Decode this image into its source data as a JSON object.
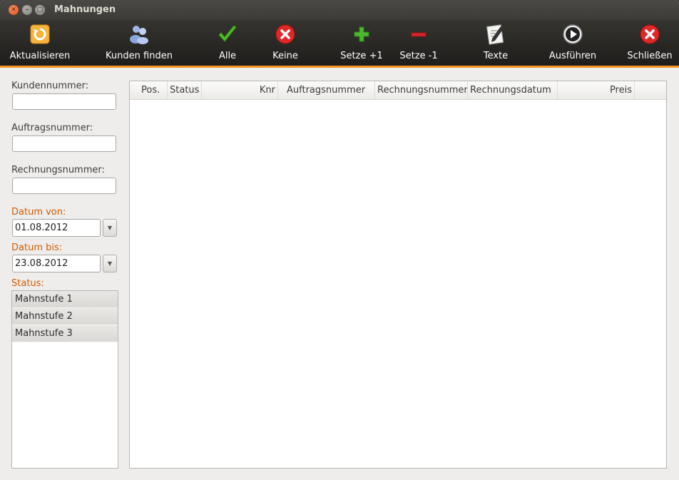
{
  "window": {
    "title": "Mahnungen"
  },
  "toolbar": {
    "items": [
      {
        "label": "Aktualisieren",
        "icon": "refresh-icon"
      },
      {
        "label": "Kunden finden",
        "icon": "users-icon"
      },
      {
        "label": "Alle",
        "icon": "checkmark-icon"
      },
      {
        "label": "Keine",
        "icon": "cancel-icon"
      },
      {
        "label": "Setze +1",
        "icon": "plus-icon"
      },
      {
        "label": "Setze -1",
        "icon": "minus-icon"
      },
      {
        "label": "Texte",
        "icon": "edit-document-icon"
      },
      {
        "label": "Ausführen",
        "icon": "play-icon"
      },
      {
        "label": "Schließen",
        "icon": "close-icon"
      }
    ]
  },
  "filters": {
    "kundennummer": {
      "label": "Kundennummer:",
      "value": ""
    },
    "auftragsnummer": {
      "label": "Auftragsnummer:",
      "value": ""
    },
    "rechnungsnummer": {
      "label": "Rechnungsnummer:",
      "value": ""
    },
    "datum_von": {
      "label": "Datum von:",
      "value": "01.08.2012"
    },
    "datum_bis": {
      "label": "Datum bis:",
      "value": "23.08.2012"
    },
    "status": {
      "label": "Status:",
      "items": [
        "Mahnstufe 1",
        "Mahnstufe 2",
        "Mahnstufe 3"
      ]
    }
  },
  "table": {
    "columns": [
      "Pos.",
      "Status",
      "Knr",
      "Auftragsnummer",
      "Rechnungsnummer",
      "Rechnungsdatum",
      "Preis"
    ],
    "rows": []
  },
  "colors": {
    "accent": "#f0951e",
    "label_accent": "#cd5c00"
  }
}
